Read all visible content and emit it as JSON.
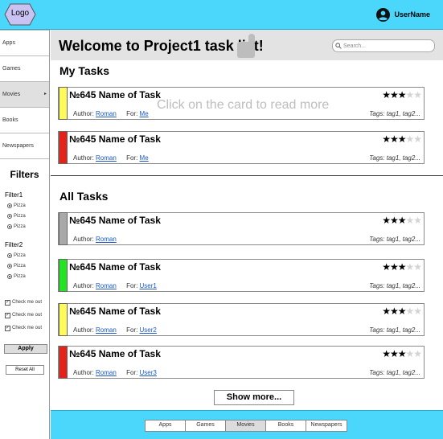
{
  "header": {
    "logo_text": "Logo",
    "user_name": "UserName"
  },
  "sidebar": {
    "items": [
      {
        "label": "Apps"
      },
      {
        "label": "Games"
      },
      {
        "label": "Movies",
        "arrow": "▸"
      },
      {
        "label": "Books"
      },
      {
        "label": "Newspapers"
      }
    ],
    "filters_title": "Filters",
    "filter1_label": "Filter1",
    "filter1_options": [
      "Pizza",
      "Pizza",
      "Pizza"
    ],
    "filter2_label": "Filter2",
    "filter2_options": [
      "Pizza",
      "Pizza",
      "Pizza"
    ],
    "checks": [
      "Check me out",
      "Check me out",
      "Check me out"
    ],
    "check_mark": "✓",
    "apply_label": "Apply",
    "reset_label": "Reset All"
  },
  "main": {
    "title": "Welcome to Project1 task list!",
    "search_placeholder": "Search...",
    "my_tasks_title": "My Tasks",
    "all_tasks_title": "All Tasks",
    "overlay_hint": "Click on the card to read more",
    "show_more_label": "Show more..."
  },
  "my_tasks": [
    {
      "title": "№645   Name of Task",
      "author_label": "Author:",
      "author": "Roman",
      "for_label": "For:",
      "for": "Me",
      "tags": "Tags: tag1, tag2...",
      "stars_on": "★★★",
      "stars_off": "★★",
      "color": "#fffb5c"
    },
    {
      "title": "№645   Name of Task",
      "author_label": "Author:",
      "author": "Roman",
      "for_label": "For:",
      "for": "Me",
      "tags": "Tags: tag1, tag2...",
      "stars_on": "★★★",
      "stars_off": "★★",
      "color": "#e3231a"
    }
  ],
  "all_tasks": [
    {
      "title": "№645   Name of Task",
      "author_label": "Author:",
      "author": "Roman",
      "for_label": "",
      "for": "",
      "tags": "Tags: tag1, tag2...",
      "stars_on": "★★★",
      "stars_off": "★★",
      "color": "#a9a9a9"
    },
    {
      "title": "№645   Name of Task",
      "author_label": "Author:",
      "author": "Roman",
      "for_label": "For:",
      "for": "User1",
      "tags": "Tags: tag1, tag2...",
      "stars_on": "★★★",
      "stars_off": "★★",
      "color": "#23e323"
    },
    {
      "title": "№645   Name of Task",
      "author_label": "Author:",
      "author": "Roman",
      "for_label": "For:",
      "for": "User2",
      "tags": "Tags: tag1, tag2...",
      "stars_on": "★★★",
      "stars_off": "★★",
      "color": "#fffb5c"
    },
    {
      "title": "№645   Name of Task",
      "author_label": "Author:",
      "author": "Roman",
      "for_label": "For:",
      "for": "User3",
      "tags": "Tags: tag1, tag2...",
      "stars_on": "★★★",
      "stars_off": "★★",
      "color": "#e3231a"
    }
  ],
  "footer": {
    "tabs": [
      {
        "label": "Apps"
      },
      {
        "label": "Games"
      },
      {
        "label": "Movies"
      },
      {
        "label": "Books"
      },
      {
        "label": "Newspapers"
      }
    ]
  },
  "colors": {
    "accent": "#4ad7fb",
    "active_gray": "#e0e0e0"
  }
}
